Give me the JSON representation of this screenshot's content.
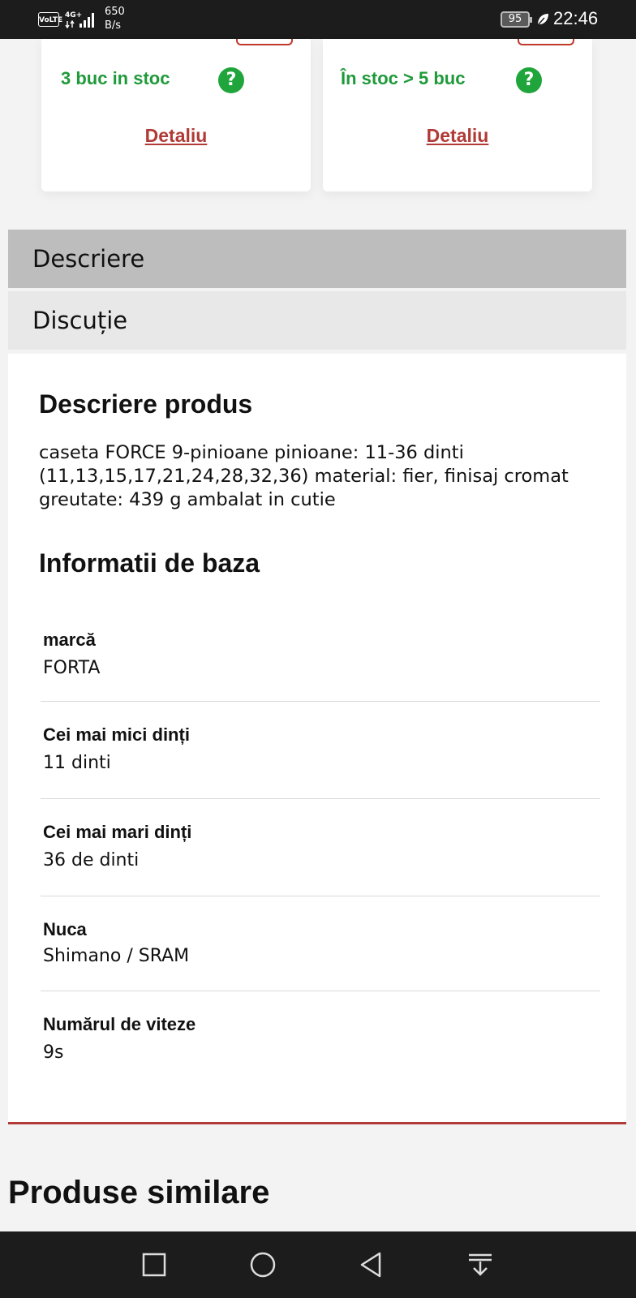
{
  "status_bar": {
    "network_badge": "VoLTE",
    "network_type": "4G+",
    "speed_value": "650",
    "speed_unit": "B/s",
    "battery": "95",
    "time": "22:46"
  },
  "stock_cards": [
    {
      "stock_text": "3 buc in stoc",
      "help_symbol": "?",
      "detail_link": "Detaliu"
    },
    {
      "stock_text": "În stoc > 5 buc",
      "help_symbol": "?",
      "detail_link": "Detaliu"
    }
  ],
  "tabs": {
    "description": "Descriere",
    "discussion": "Discuție"
  },
  "product_description": {
    "heading": "Descriere produs",
    "text": "caseta FORCE 9-pinioane pinioane: 11-36 dinti (11,13,15,17,21,24,28,32,36) material: fier, finisaj cromat greutate: 439 g ambalat in cutie"
  },
  "basic_info": {
    "heading": "Informatii de baza",
    "rows": [
      {
        "label": "marcă",
        "value": "FORTA"
      },
      {
        "label": "Cei mai mici dinți",
        "value": "11 dinti"
      },
      {
        "label": "Cei mai mari dinți",
        "value": "36 de dinti"
      },
      {
        "label": "Nuca",
        "value": "Shimano / SRAM"
      },
      {
        "label": "Numărul de viteze",
        "value": "9s"
      }
    ]
  },
  "similar_products": {
    "heading": "Produse similare"
  },
  "colors": {
    "accent_red": "#b03a36",
    "stock_green": "#1f9a3a",
    "active_tab": "#bdbdbd",
    "inactive_tab": "#e8e8e8"
  },
  "nav_bar": {
    "icons": [
      "recent-apps-icon",
      "home-icon",
      "back-icon",
      "notification-pulldown-icon"
    ]
  }
}
